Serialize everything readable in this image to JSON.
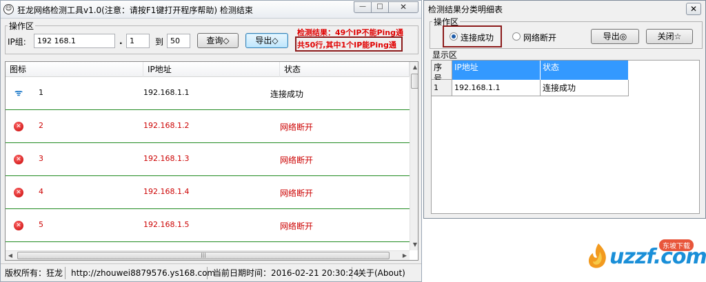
{
  "main": {
    "title": "狂龙网络检测工具v1.0(注意：请按F1键打开程序帮助)  检测结束",
    "window_controls": {
      "minimize": "—",
      "maximize": "□",
      "close": "✕"
    },
    "op_legend": "操作区",
    "ip_group_label": "IP组:",
    "ip_prefix": "192 168.1",
    "dot": ".",
    "range_start": "1",
    "to_label": "到",
    "range_end": "50",
    "query_button": "查询◇",
    "export_button": "导出◇",
    "result_line1": "检测结果：49个IP不能Ping通",
    "result_line2": "共50行,其中1个IP能Ping通",
    "columns": [
      "图标",
      "IP地址",
      "状态"
    ],
    "rows": [
      {
        "index": "1",
        "ip": "192.168.1.1",
        "status": "连接成功",
        "ok": true
      },
      {
        "index": "2",
        "ip": "192.168.1.2",
        "status": "网络断开",
        "ok": false
      },
      {
        "index": "3",
        "ip": "192.168.1.3",
        "status": "网络断开",
        "ok": false
      },
      {
        "index": "4",
        "ip": "192.168.1.4",
        "status": "网络断开",
        "ok": false
      },
      {
        "index": "5",
        "ip": "192.168.1.5",
        "status": "网络断开",
        "ok": false
      }
    ],
    "statusbar": {
      "copyright": "版权所有：狂龙",
      "url": "http://zhouwei8879576.ys168.com",
      "datetime": "当前日期时间：2016-02-21 20:30:24",
      "about": "关于(About)"
    }
  },
  "detail": {
    "title": "检测结果分类明细表",
    "close": "✕",
    "op_legend": "操作区",
    "radio_success": "连接成功",
    "radio_disconnected": "网络断开",
    "export_button": "导出◎",
    "close_button": "关闭☆",
    "display_legend": "显示区",
    "columns": [
      "序号",
      "IP地址",
      "状态"
    ],
    "rows": [
      {
        "index": "1",
        "ip": "192.168.1.1",
        "status": "连接成功"
      }
    ]
  },
  "watermark": {
    "text": "uzzf.com",
    "tag": "东坡下载"
  },
  "colors": {
    "accent": "#3399ff",
    "error": "#cc0000",
    "row_border": "#1f8a1f",
    "highlight_box": "#8b1a1a"
  }
}
